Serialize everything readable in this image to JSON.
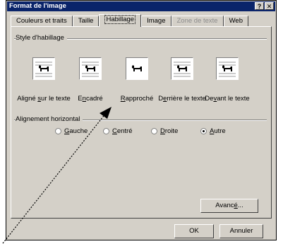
{
  "dialog": {
    "title": "Format de l'image",
    "help_glyph": "?",
    "close_glyph": "✕"
  },
  "tabs": [
    "Couleurs et traits",
    "Taille",
    "Habillage",
    "Image",
    "Zone de texte",
    "Web"
  ],
  "wrap": {
    "group_label": "Style d'habillage",
    "items": [
      {
        "pre": "Aligné ",
        "u": "s",
        "post": "ur le texte"
      },
      {
        "pre": "E",
        "u": "n",
        "post": "cadré"
      },
      {
        "pre": "",
        "u": "R",
        "post": "approché"
      },
      {
        "pre": "D",
        "u": "e",
        "post": "rrière le texte"
      },
      {
        "pre": "De",
        "u": "v",
        "post": "ant le texte"
      }
    ]
  },
  "align": {
    "group_label": "Alignement horizontal",
    "options": [
      {
        "u": "G",
        "post": "auche",
        "selected": false
      },
      {
        "u": "C",
        "post": "entré",
        "selected": false
      },
      {
        "u": "D",
        "post": "roite",
        "selected": false
      },
      {
        "u": "A",
        "post": "utre",
        "selected": true
      }
    ]
  },
  "buttons": {
    "advanced_pre": "Avanc",
    "advanced_u": "é",
    "advanced_post": "...",
    "ok": "OK",
    "cancel": "Annuler"
  }
}
